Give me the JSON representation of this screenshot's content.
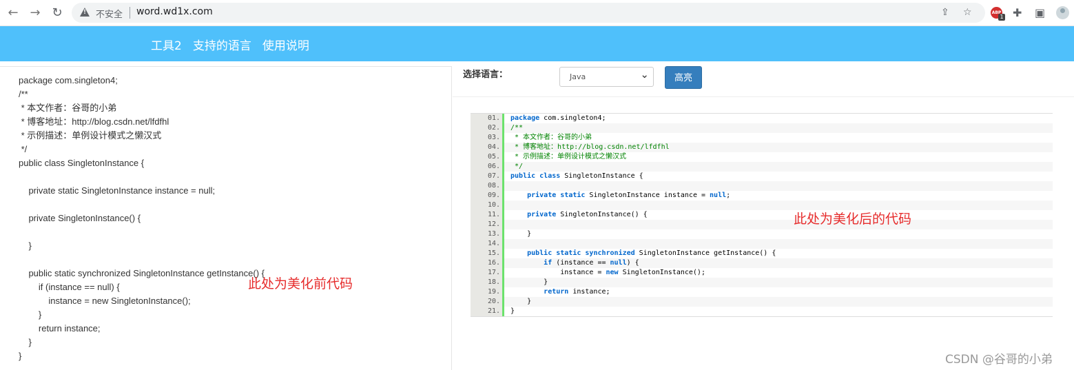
{
  "browser": {
    "security_label": "不安全",
    "url": "word.wd1x.com",
    "extension_badge": "ABP",
    "extension_count": "1"
  },
  "site": {
    "nav": [
      "工具2",
      "支持的语言",
      "使用说明"
    ],
    "accent_color": "#4fc0fb"
  },
  "editor": {
    "raw_code": "package com.singleton4;\n/**\n * 本文作者：谷哥的小弟\n * 博客地址：http://blog.csdn.net/lfdfhl\n * 示例描述：单例设计模式之懒汉式\n */\npublic class SingletonInstance {\n\n\tprivate static SingletonInstance instance = null;\n\n\tprivate SingletonInstance() {\n\n\t}\n\n\tpublic static synchronized SingletonInstance getInstance() {\n\t\tif (instance == null) {\n\t\t\tinstance = new SingletonInstance();\n\t\t}\n\t\treturn instance;\n\t}\n}",
    "note": "此处为美化前代码"
  },
  "controls": {
    "language_label": "选择语言：",
    "language_selected": "Java",
    "highlight_button": "高亮"
  },
  "highlighted": {
    "note": "此处为美化后的代码",
    "lines": [
      {
        "no": "01.",
        "code": "package com.singleton4;",
        "type": "kw-lead"
      },
      {
        "no": "02.",
        "code": "/**",
        "type": "comment"
      },
      {
        "no": "03.",
        "code": " * 本文作者：谷哥的小弟",
        "type": "comment"
      },
      {
        "no": "04.",
        "code": " * 博客地址：http://blog.csdn.net/lfdfhl",
        "type": "comment"
      },
      {
        "no": "05.",
        "code": " * 示例描述：单例设计模式之懒汉式",
        "type": "comment"
      },
      {
        "no": "06.",
        "code": " */",
        "type": "comment"
      },
      {
        "no": "07.",
        "code": "public class SingletonInstance {",
        "type": "code"
      },
      {
        "no": "08.",
        "code": "",
        "type": "code"
      },
      {
        "no": "09.",
        "code": "    private static SingletonInstance instance = null;",
        "type": "code"
      },
      {
        "no": "10.",
        "code": "",
        "type": "code"
      },
      {
        "no": "11.",
        "code": "    private SingletonInstance() {",
        "type": "code"
      },
      {
        "no": "12.",
        "code": "",
        "type": "code"
      },
      {
        "no": "13.",
        "code": "    }",
        "type": "code"
      },
      {
        "no": "14.",
        "code": "",
        "type": "code"
      },
      {
        "no": "15.",
        "code": "    public static synchronized SingletonInstance getInstance() {",
        "type": "code"
      },
      {
        "no": "16.",
        "code": "        if (instance == null) {",
        "type": "code"
      },
      {
        "no": "17.",
        "code": "            instance = new SingletonInstance();",
        "type": "code"
      },
      {
        "no": "18.",
        "code": "        }",
        "type": "code"
      },
      {
        "no": "19.",
        "code": "        return instance;",
        "type": "code"
      },
      {
        "no": "20.",
        "code": "    }",
        "type": "code"
      },
      {
        "no": "21.",
        "code": "}",
        "type": "code"
      }
    ]
  },
  "watermark": "CSDN @谷哥的小弟"
}
